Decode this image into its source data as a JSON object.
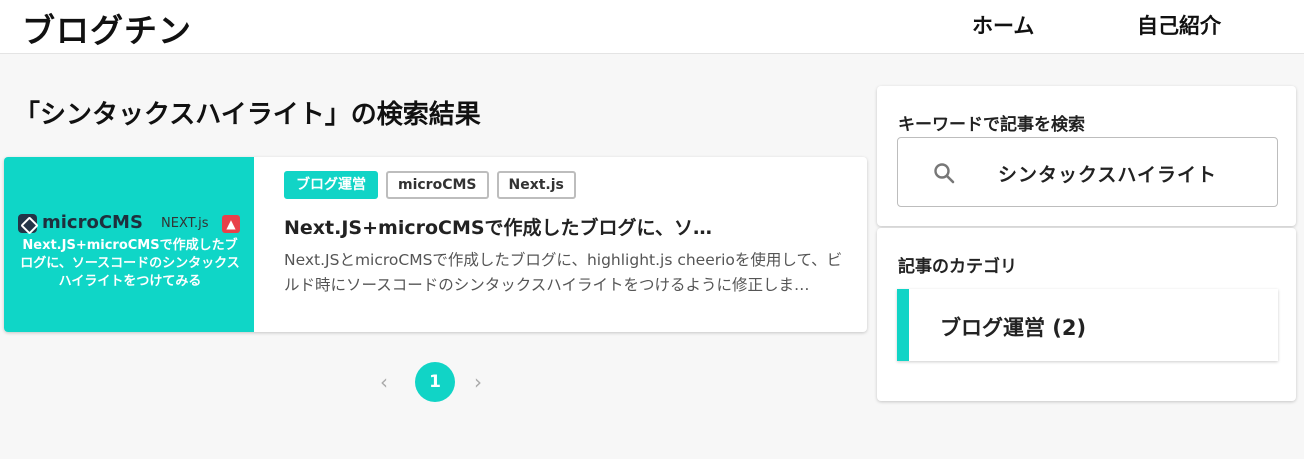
{
  "header": {
    "logo": "ブログチン",
    "nav": [
      {
        "label": "ホーム"
      },
      {
        "label": "自己紹介"
      }
    ]
  },
  "main": {
    "page_title": "「シンタックスハイライト」の検索結果",
    "posts": [
      {
        "thumbnail": {
          "logos": [
            "microCMS",
            "NEXT.js"
          ],
          "caption": "Next.JS+microCMSで作成したブログに、ソースコードのシンタックスハイライトをつけてみる"
        },
        "tags": [
          "ブログ運営",
          "microCMS",
          "Next.js"
        ],
        "title": "Next.JS+microCMSで作成したブログに、ソ…",
        "excerpt": "Next.JSとmicroCMSで作成したブログに、highlight.js cheerioを使用して、ビルド時にソースコードのシンタックスハイライトをつけるように修正しま…"
      }
    ],
    "pagination": {
      "prev": "‹",
      "current": "1",
      "next": "›"
    }
  },
  "sidebar": {
    "search": {
      "title": "キーワードで記事を検索",
      "value": "シンタックスハイライト",
      "icon": "search-icon"
    },
    "categories": {
      "title": "記事のカテゴリ",
      "items": [
        {
          "label": "ブログ運営 (2)"
        }
      ]
    }
  },
  "colors": {
    "accent": "#11d4c6",
    "thumbnail_bg": "#0fd6c7"
  }
}
